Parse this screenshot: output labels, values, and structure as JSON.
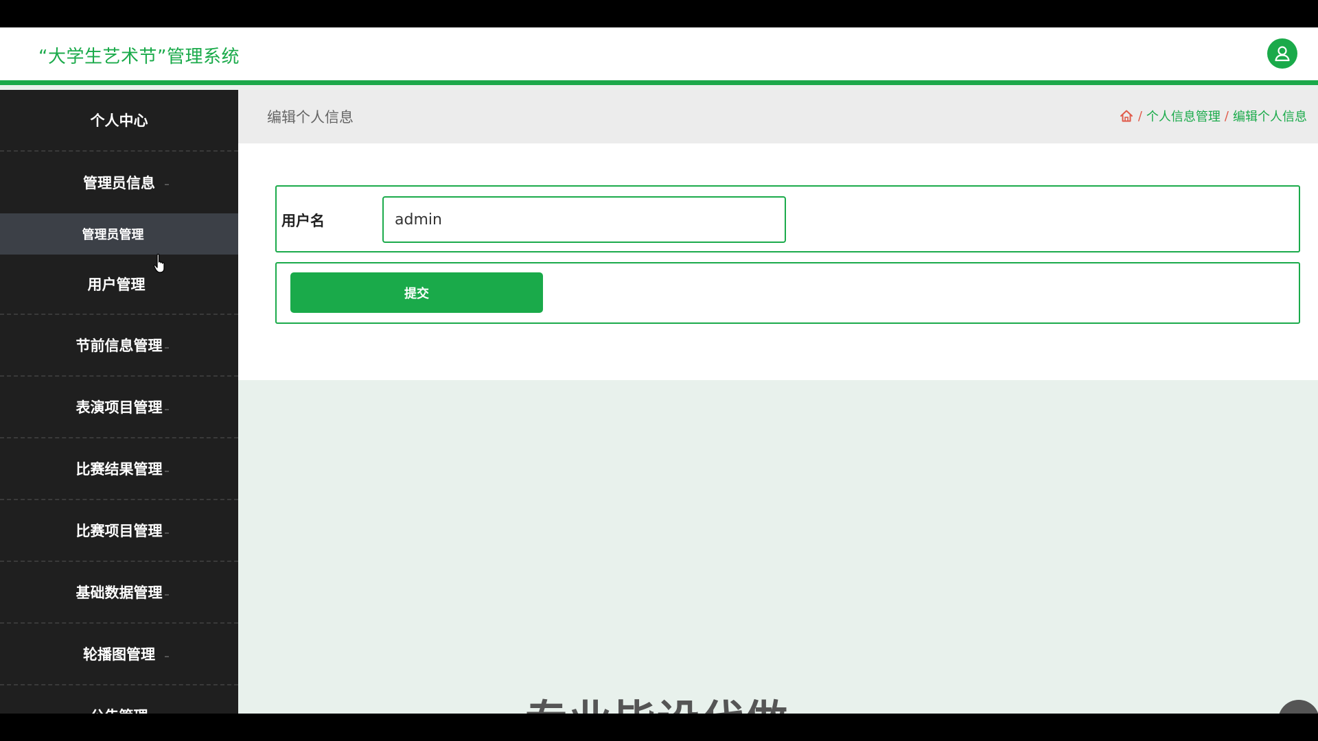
{
  "header": {
    "app_title": "“大学生艺术节”管理系统",
    "avatar_icon": "user-icon"
  },
  "sidebar": {
    "items": [
      {
        "label": "个人中心"
      },
      {
        "label": "管理员信息"
      },
      {
        "label": "管理员管理"
      },
      {
        "label": "用户管理"
      },
      {
        "label": "节前信息管理"
      },
      {
        "label": "表演项目管理"
      },
      {
        "label": "比赛结果管理"
      },
      {
        "label": "比赛项目管理"
      },
      {
        "label": "基础数据管理"
      },
      {
        "label": "轮播图管理"
      },
      {
        "label": "公告管理"
      }
    ]
  },
  "breadcrumb": {
    "page_title": "编辑个人信息",
    "home_icon": "home-icon",
    "separator": "/",
    "level1": "个人信息管理",
    "level2": "编辑个人信息"
  },
  "form": {
    "username_label": "用户名",
    "username_value": "admin",
    "submit_label": "提交"
  },
  "background": {
    "partial_text": "专业毕设代做"
  },
  "colors": {
    "accent": "#1aaa4a",
    "sidebar_bg": "#1f1f1f",
    "active_sub_bg": "#3c4047",
    "breadcrumb_sep": "#e05a4a"
  }
}
